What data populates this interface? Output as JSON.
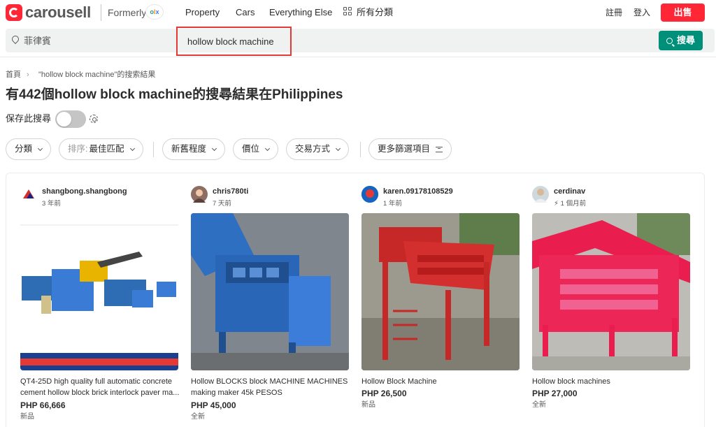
{
  "brand": {
    "name": "carousell",
    "formerly": "Formerly",
    "olx": "olx"
  },
  "nav": {
    "property": "Property",
    "cars": "Cars",
    "everything_else": "Everything Else",
    "all_categories": "所有分類",
    "register": "註冊",
    "login": "登入",
    "sell": "出售"
  },
  "search": {
    "location": "菲律賓",
    "query": "hollow block machine",
    "button": "搜尋"
  },
  "breadcrumb": {
    "home": "首頁",
    "sep": "›",
    "current": "\"hollow block machine\"的搜索結果"
  },
  "page_title": "有442個hollow block machine的搜尋結果在Philippines",
  "save_search": {
    "label": "保存此搜尋",
    "enabled": false
  },
  "filters": {
    "category": "分類",
    "sort_prefix": "排序:",
    "sort_value": "最佳匹配",
    "condition": "新舊程度",
    "price": "價位",
    "deal": "交易方式",
    "more": "更多篩選項目"
  },
  "listings": [
    {
      "seller": "shangbong.shangbong",
      "age": "3 年前",
      "title": "QT4-25D high quality full automatic concrete cement hollow block brick interlock paver ma...",
      "price": "PHP 66,666",
      "condition": "新品"
    },
    {
      "seller": "chris780ti",
      "age": "7 天前",
      "title": "Hollow BLOCKS block MACHINE MACHINES making maker 45k PESOS",
      "price": "PHP 45,000",
      "condition": "全新"
    },
    {
      "seller": "karen.09178108529",
      "age": "1 年前",
      "title": "Hollow Block Machine",
      "price": "PHP 26,500",
      "condition": "新品"
    },
    {
      "seller": "cerdinav",
      "age": "1 個月前",
      "title": "Hollow block machines",
      "price": "PHP 27,000",
      "condition": "全新"
    }
  ],
  "colors": {
    "brand_red": "#ff2636",
    "search_green": "#008f79",
    "highlight_box": "#e53935"
  }
}
